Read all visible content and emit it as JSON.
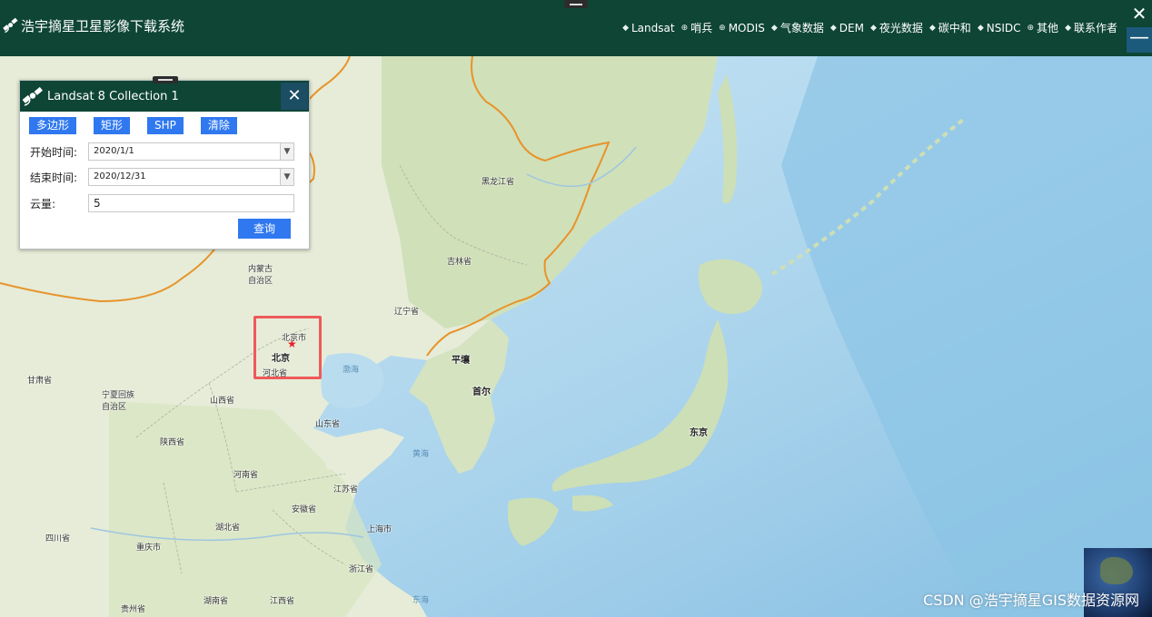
{
  "header": {
    "title": "浩宇摘星卫星影像下载系统",
    "nav": [
      {
        "label": "Landsat",
        "icon": "share-icon"
      },
      {
        "label": "哨兵",
        "icon": "globe-icon"
      },
      {
        "label": "MODIS",
        "icon": "globe-icon"
      },
      {
        "label": "气象数据",
        "icon": "share-icon"
      },
      {
        "label": "DEM",
        "icon": "share-icon"
      },
      {
        "label": "夜光数据",
        "icon": "share-icon"
      },
      {
        "label": "碳中和",
        "icon": "share-icon"
      },
      {
        "label": "NSIDC",
        "icon": "share-icon"
      },
      {
        "label": "其他",
        "icon": "globe-icon"
      },
      {
        "label": "联系作者",
        "icon": "share-icon"
      }
    ],
    "close_glyph": "✕",
    "minimize_glyph": "—"
  },
  "panel": {
    "title": "Landsat 8 Collection 1",
    "close_glyph": "✕",
    "tools": [
      "多边形",
      "矩形",
      "SHP",
      "清除"
    ],
    "start": {
      "label": "开始时间:",
      "value": "2020/1/1"
    },
    "end": {
      "label": "结束时间:",
      "value": "2020/12/31"
    },
    "cloud": {
      "label": "云量:",
      "value": "5"
    },
    "query_label": "查询"
  },
  "map": {
    "labels": [
      {
        "text": "黑龙江省",
        "kind": "land"
      },
      {
        "text": "吉林省",
        "kind": "land"
      },
      {
        "text": "内蒙古",
        "kind": "land"
      },
      {
        "text": "自治区",
        "kind": "land"
      },
      {
        "text": "辽宁省",
        "kind": "land"
      },
      {
        "text": "北京市",
        "kind": "land"
      },
      {
        "text": "北京",
        "kind": "big"
      },
      {
        "text": "河北省",
        "kind": "land"
      },
      {
        "text": "渤海",
        "kind": "sea"
      },
      {
        "text": "平壤",
        "kind": "big"
      },
      {
        "text": "首尔",
        "kind": "big"
      },
      {
        "text": "甘肃省",
        "kind": "land"
      },
      {
        "text": "宁夏回族",
        "kind": "land"
      },
      {
        "text": "自治区",
        "kind": "land"
      },
      {
        "text": "山西省",
        "kind": "land"
      },
      {
        "text": "山东省",
        "kind": "land"
      },
      {
        "text": "陕西省",
        "kind": "land"
      },
      {
        "text": "黄海",
        "kind": "sea"
      },
      {
        "text": "河南省",
        "kind": "land"
      },
      {
        "text": "江苏省",
        "kind": "land"
      },
      {
        "text": "安徽省",
        "kind": "land"
      },
      {
        "text": "东京",
        "kind": "big"
      },
      {
        "text": "湖北省",
        "kind": "land"
      },
      {
        "text": "上海市",
        "kind": "land"
      },
      {
        "text": "四川省",
        "kind": "land"
      },
      {
        "text": "重庆市",
        "kind": "land"
      },
      {
        "text": "浙江省",
        "kind": "land"
      },
      {
        "text": "贵州省",
        "kind": "land"
      },
      {
        "text": "湖南省",
        "kind": "land"
      },
      {
        "text": "江西省",
        "kind": "land"
      },
      {
        "text": "东海",
        "kind": "sea"
      }
    ],
    "watermark": "CSDN @浩宇摘星GIS数据资源网",
    "star_glyph": "★"
  },
  "colors": {
    "header_bg": "#0e4535",
    "button_blue": "#2f78f0",
    "highlight_red": "#ee5a5a",
    "border_orange": "#e8932a"
  }
}
